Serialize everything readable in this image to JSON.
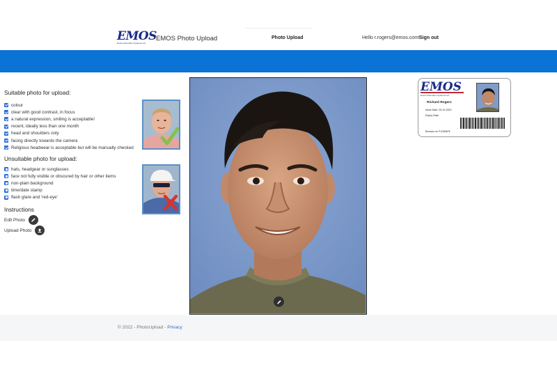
{
  "header": {
    "logo_text": "EMOS",
    "logo_subtitle": "Emos Information Systems Ltd",
    "app_name": "EMOS Photo Upload",
    "nav_link": "Photo Upload",
    "greeting": "Hello r.rogers@emos.com!",
    "sign_out": "Sign out"
  },
  "colors": {
    "accent_bar": "#0b72d6",
    "checkbox": "#2f6fd6",
    "brand": "#1b2b8a"
  },
  "suitable": {
    "title": "Suitable photo for upload:",
    "items": [
      "colour",
      "clear with good contrast, in focus",
      "a natural expression, smiling is acceptable!",
      "recent, ideally less than one month",
      "head and shoulders only",
      "facing directly towards the camera",
      "Religious headwear is acceptable but will be manually checked"
    ]
  },
  "unsuitable": {
    "title": "Unsuitable photo for upload:",
    "items": [
      "hats, headgear or sunglasses",
      "face not fully visible or obscured by hair or other items",
      "non-plain background",
      "time/date stamp",
      "flash glare and 'red-eye'"
    ]
  },
  "instructions": {
    "title": "Instructions",
    "edit_label": "Edit Photo",
    "upload_label": "Upload Photo"
  },
  "icons": {
    "edit": "pencil-icon",
    "upload": "upload-icon",
    "good_example": "checkmark-icon",
    "bad_example": "cross-icon"
  },
  "id_card": {
    "logo_text": "EMOS",
    "logo_subtitle": "Emos Information Systems Ltd",
    "name": "Richard Rogers",
    "issue_date": "Issue Date: 29-10-2023",
    "expiry_date": "Expiry Date:",
    "borrower": "Borrower no: P12345678"
  },
  "footer": {
    "copyright": "© 2022 - PhotoUpload - ",
    "privacy_link": "Privacy"
  }
}
